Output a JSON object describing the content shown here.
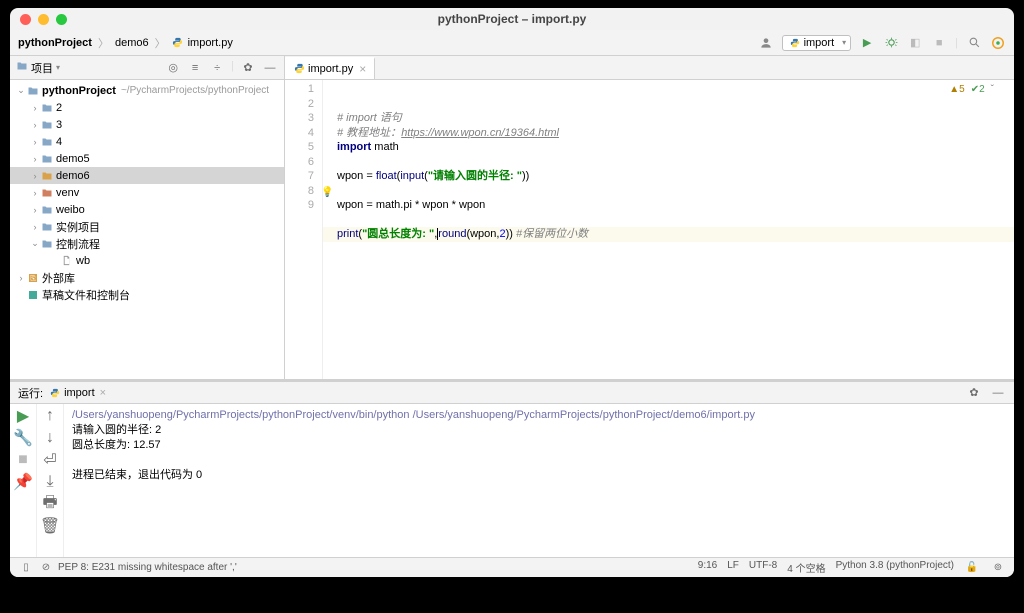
{
  "window": {
    "title": "pythonProject – import.py"
  },
  "breadcrumb": {
    "project": "pythonProject",
    "folder": "demo6",
    "file": "import.py"
  },
  "nav": {
    "run_config": "import"
  },
  "sidebar": {
    "title": "项目",
    "root": {
      "name": "pythonProject",
      "path": "~/PycharmProjects/pythonProject"
    },
    "items": [
      {
        "name": "2",
        "depth": 1,
        "arrow": "›",
        "icon": "folder"
      },
      {
        "name": "3",
        "depth": 1,
        "arrow": "›",
        "icon": "folder"
      },
      {
        "name": "4",
        "depth": 1,
        "arrow": "›",
        "icon": "folder"
      },
      {
        "name": "demo5",
        "depth": 1,
        "arrow": "›",
        "icon": "folder"
      },
      {
        "name": "demo6",
        "depth": 1,
        "arrow": "›",
        "icon": "folder-open",
        "sel": true
      },
      {
        "name": "venv",
        "depth": 1,
        "arrow": "›",
        "icon": "folder-lib"
      },
      {
        "name": "weibo",
        "depth": 1,
        "arrow": "›",
        "icon": "folder"
      },
      {
        "name": "实例项目",
        "depth": 1,
        "arrow": "›",
        "icon": "folder"
      },
      {
        "name": "控制流程",
        "depth": 1,
        "arrow": "⌄",
        "icon": "folder"
      },
      {
        "name": "wb",
        "depth": 2,
        "arrow": "",
        "icon": "file"
      },
      {
        "name": "外部库",
        "depth": 0,
        "arrow": "›",
        "icon": "ext"
      },
      {
        "name": "草稿文件和控制台",
        "depth": 0,
        "arrow": "",
        "icon": "scratch"
      }
    ]
  },
  "tab": {
    "name": "import.py"
  },
  "code": {
    "annotations": {
      "warn": "5",
      "ok": "2"
    },
    "lines": [
      {
        "n": "1",
        "html": "<span class='comment'># import 语句</span>"
      },
      {
        "n": "2",
        "html": "<span class='comment'># 教程地址：<u>https://www.wpon.cn/19364.html</u></span>"
      },
      {
        "n": "3",
        "html": "<span class='kw'>import</span> math"
      },
      {
        "n": "4",
        "html": ""
      },
      {
        "n": "5",
        "html": "wpon = <span class='builtin'>float</span>(<span class='builtin'>input</span>(<span class='str'>\"请输入圆的半径: \"</span>))"
      },
      {
        "n": "6",
        "html": ""
      },
      {
        "n": "7",
        "html": "wpon = math.pi * wpon * wpon"
      },
      {
        "n": "8",
        "html": ""
      },
      {
        "n": "9",
        "html": "<span class='builtin'>print</span>(<span class='str'>\"圆总长度为: \"</span>,<span style='border-left:1px solid #000'></span><span class='builtin'>round</span>(wpon,<span style='color:#0000ff'>2</span>)) <span class='comment'>#保留两位小数</span>",
        "hl": true
      }
    ]
  },
  "run_panel": {
    "title": "运行:",
    "tab": "import",
    "path": "/Users/yanshuopeng/PycharmProjects/pythonProject/venv/bin/python /Users/yanshuopeng/PycharmProjects/pythonProject/demo6/import.py",
    "line1": "请输入圆的半径: 2",
    "line2": "圆总长度为:  12.57",
    "exit": "进程已结束，退出代码为 0"
  },
  "status": {
    "left_icon": "",
    "msg": "PEP 8: E231 missing whitespace after ','",
    "pos": "9:16",
    "sep": "LF",
    "enc": "UTF-8",
    "indent": "4 个空格",
    "sdk": "Python 3.8 (pythonProject)"
  }
}
